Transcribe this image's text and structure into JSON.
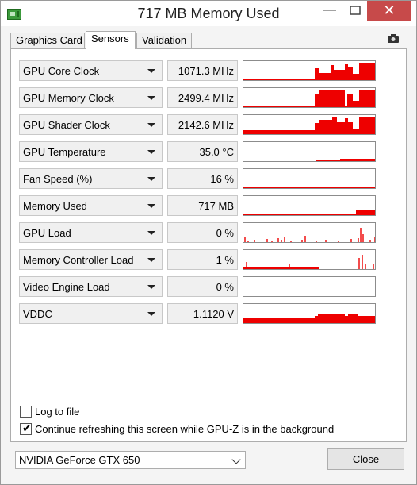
{
  "window": {
    "title": "717 MB Memory Used",
    "minimize_glyph": "—",
    "close_glyph": "✕"
  },
  "tabs": [
    {
      "label": "Graphics Card",
      "active": false
    },
    {
      "label": "Sensors",
      "active": true
    },
    {
      "label": "Validation",
      "active": false
    }
  ],
  "sensors": [
    {
      "name": "GPU Core Clock",
      "value": "1071.3 MHz"
    },
    {
      "name": "GPU Memory Clock",
      "value": "2499.4 MHz"
    },
    {
      "name": "GPU Shader Clock",
      "value": "2142.6 MHz"
    },
    {
      "name": "GPU Temperature",
      "value": "35.0 °C"
    },
    {
      "name": "Fan Speed (%)",
      "value": "16 %"
    },
    {
      "name": "Memory Used",
      "value": "717 MB"
    },
    {
      "name": "GPU Load",
      "value": "0 %"
    },
    {
      "name": "Memory Controller Load",
      "value": "1 %"
    },
    {
      "name": "Video Engine Load",
      "value": "0 %"
    },
    {
      "name": "VDDC",
      "value": "1.1120 V"
    }
  ],
  "options": {
    "log_to_file": {
      "label": "Log to file",
      "checked": false
    },
    "continue_refreshing": {
      "label": "Continue refreshing this screen while GPU-Z is in the background",
      "checked": true
    }
  },
  "device_select": {
    "value": "NVIDIA GeForce GTX 650"
  },
  "close_button": {
    "label": "Close"
  },
  "colors": {
    "graph_fill": "#ee0000"
  }
}
